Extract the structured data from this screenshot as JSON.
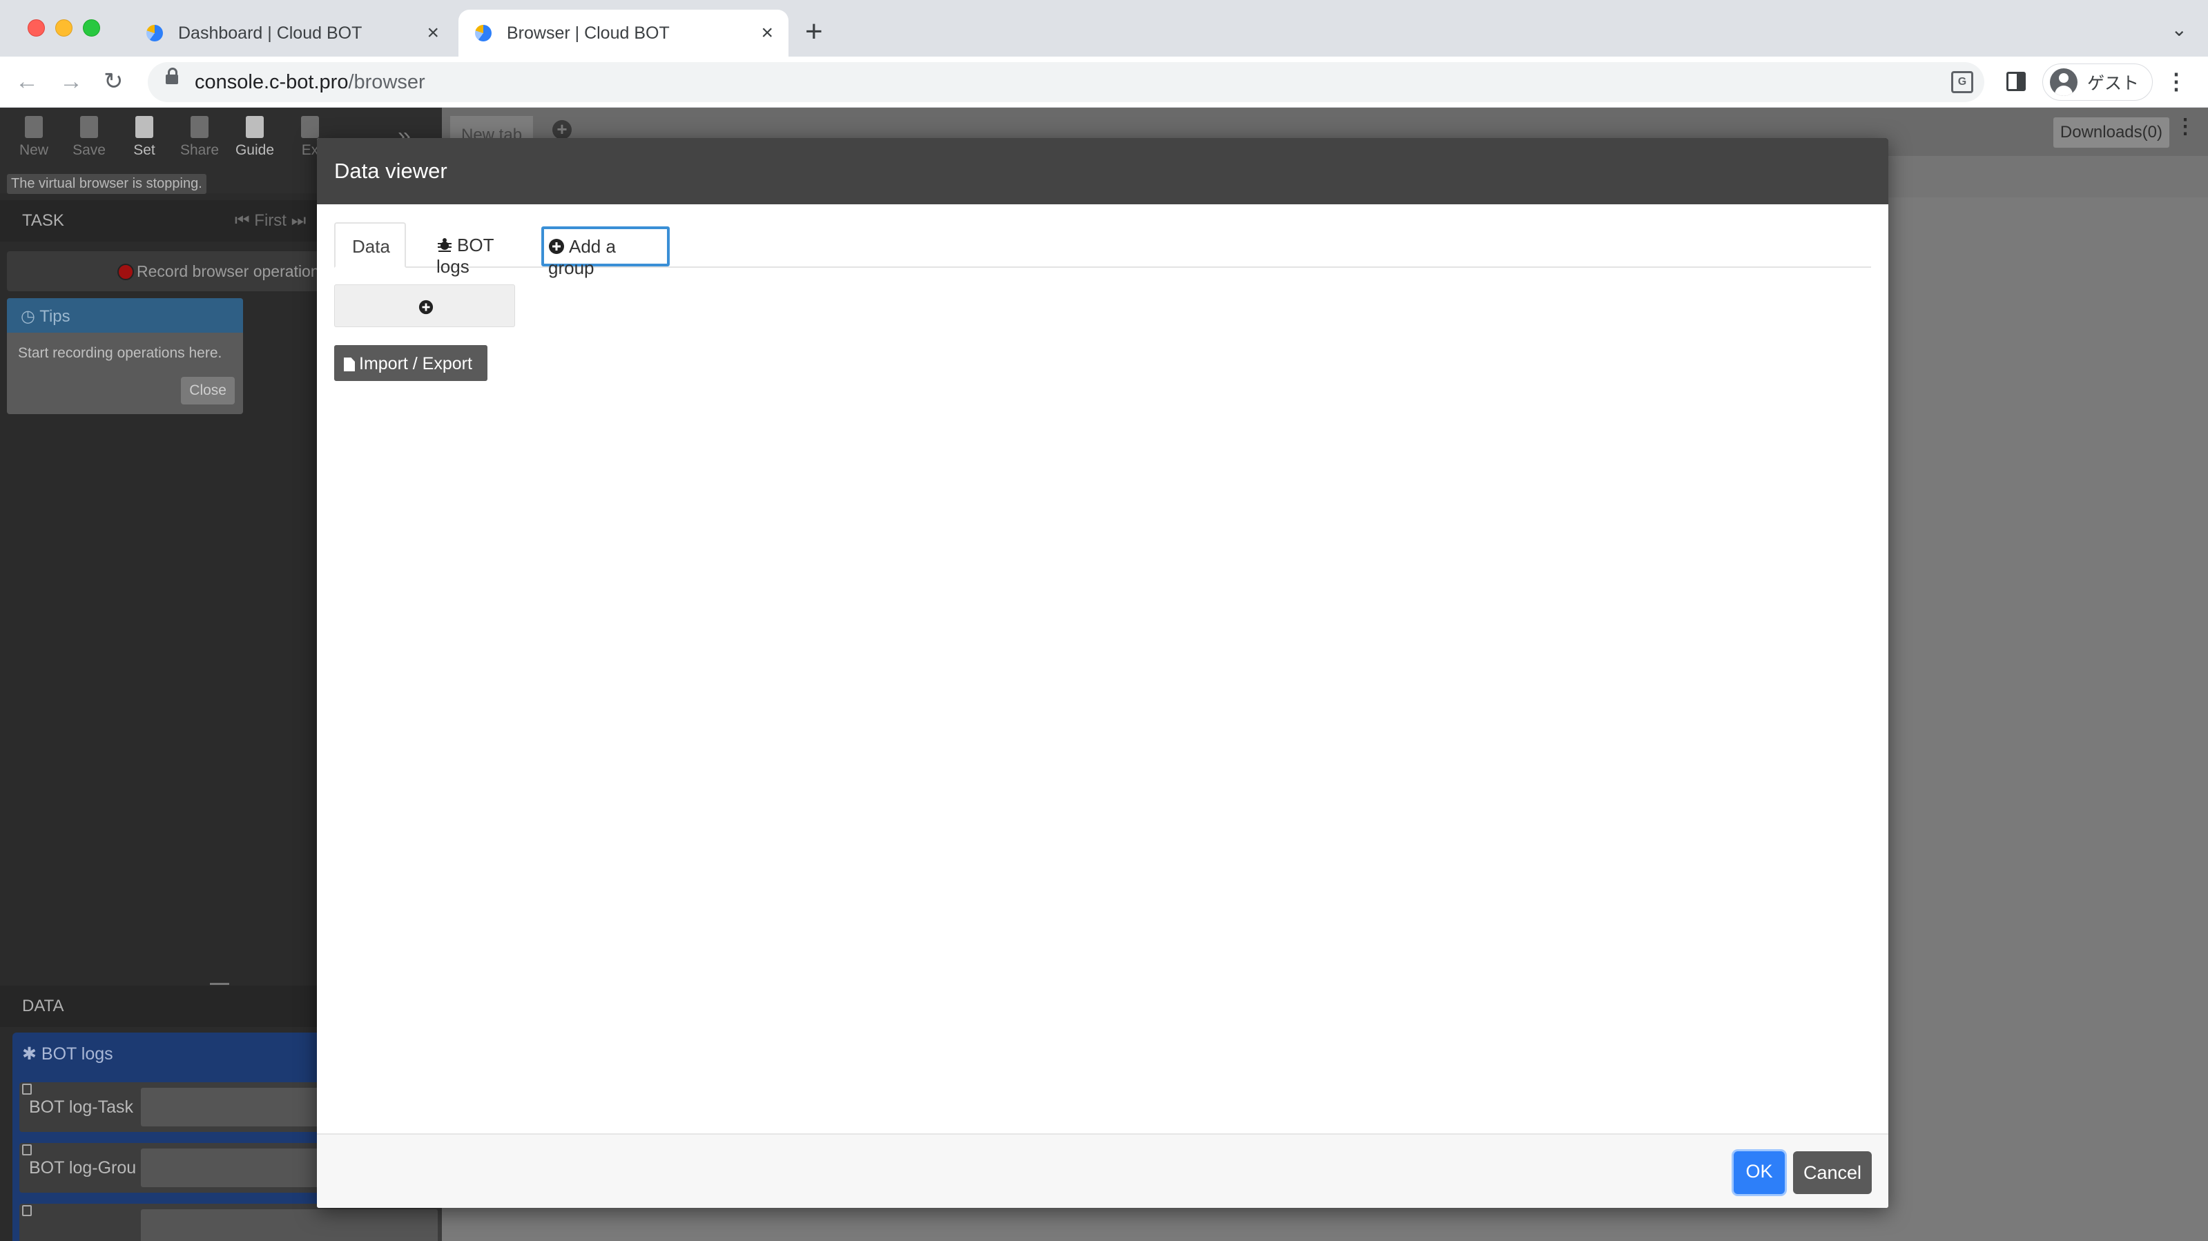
{
  "browser": {
    "tabs": [
      {
        "title": "Dashboard | Cloud BOT"
      },
      {
        "title": "Browser | Cloud BOT"
      }
    ],
    "url": {
      "host": "console.c-bot.pro",
      "path": "/browser"
    },
    "profile_name": "ゲスト"
  },
  "app": {
    "toolbar": {
      "new": "New",
      "save": "Save",
      "set": "Set",
      "share": "Share",
      "guide": "Guide",
      "exit": "Ex"
    },
    "status": "The virtual browser is stopping.",
    "task_header": "TASK",
    "task_nav_first": "First",
    "record_label": "Record browser operation",
    "tips": {
      "title": "Tips",
      "body": "Start recording operations here.",
      "close": "Close"
    },
    "data_header": "DATA",
    "data_group": "BOT logs",
    "data_items": [
      "BOT log-Task",
      "BOT log-Grou"
    ],
    "right_tabs": {
      "new_tab": "New tab",
      "downloads": "Downloads(0)"
    }
  },
  "modal": {
    "title": "Data viewer",
    "tabs": {
      "data": "Data",
      "bot_logs": "BOT logs",
      "add_group": "Add a group"
    },
    "import_export": "Import / Export",
    "ok": "OK",
    "cancel": "Cancel"
  },
  "colors": {
    "accent": "#2d7ff9",
    "modal_header": "#444444",
    "focus_ring": "#3a8fd6"
  }
}
